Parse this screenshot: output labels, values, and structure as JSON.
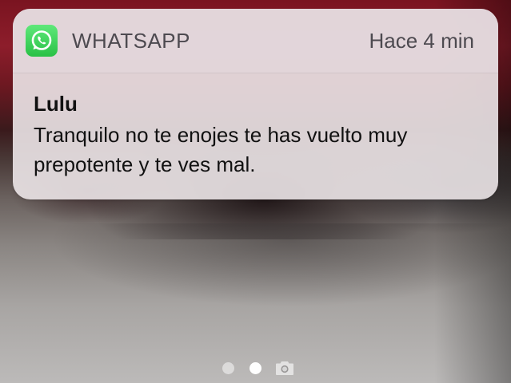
{
  "notification": {
    "app_name": "WHATSAPP",
    "app_icon": "whatsapp-icon",
    "time": "Hace 4 min",
    "sender": "Lulu",
    "message": "Tranquilo no te enojes te has vuelto muy prepotente y te ves mal."
  },
  "page_indicator": {
    "pages": [
      "dot",
      "dot",
      "camera-icon"
    ],
    "current_page": 2
  },
  "colors": {
    "whatsapp_green": "#29c146",
    "notification_bg": "#ece5e8",
    "header_text": "#4d4a50",
    "body_text": "#111111"
  }
}
